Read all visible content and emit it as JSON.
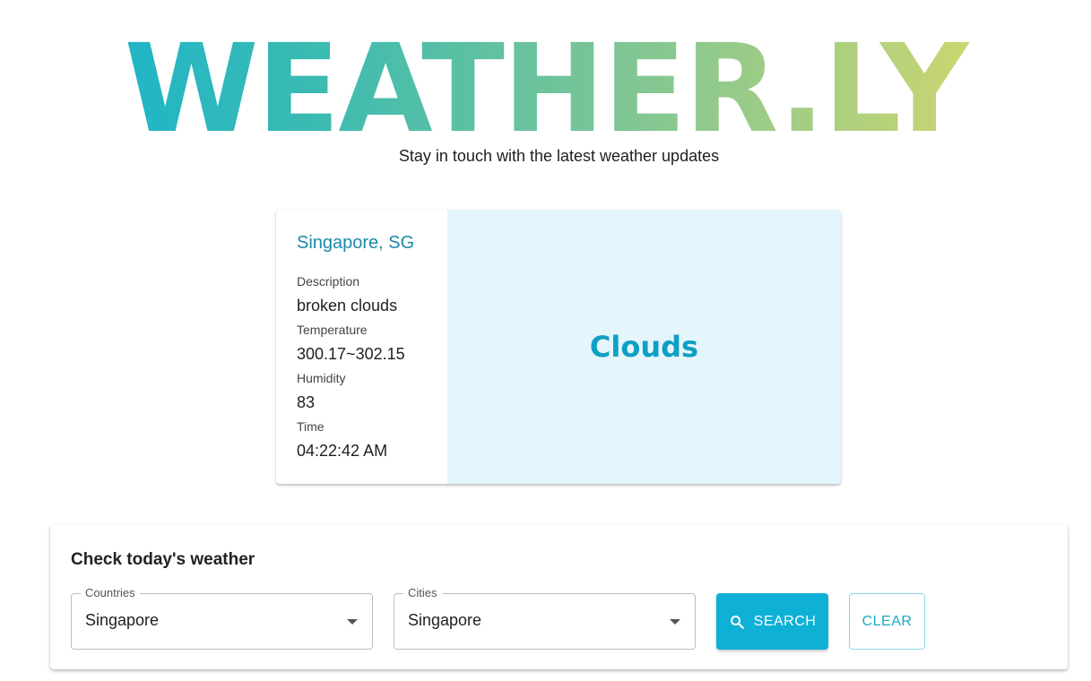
{
  "app": {
    "logo": "WEATHER.LY",
    "tagline": "Stay in touch with the latest weather updates"
  },
  "weather": {
    "location": "Singapore, SG",
    "description_label": "Description",
    "description": "broken clouds",
    "temperature_label": "Temperature",
    "temperature": "300.17~302.15",
    "humidity_label": "Humidity",
    "humidity": "83",
    "time_label": "Time",
    "time": "04:22:42 AM",
    "condition": "Clouds"
  },
  "search": {
    "title": "Check today's weather",
    "countries_label": "Countries",
    "countries_value": "Singapore",
    "cities_label": "Cities",
    "cities_value": "Singapore",
    "search_label": "SEARCH",
    "clear_label": "CLEAR"
  },
  "colors": {
    "accent": "#0fb0d6",
    "location_text": "#1a8aa8",
    "condition_bg": "#e4f5fb",
    "logo_gradient_start": "#0fb2d4",
    "logo_gradient_end": "#e6dc5e"
  },
  "icons": {
    "search_button_icon": "search-icon",
    "select_arrow_icon": "dropdown-arrow-icon"
  }
}
